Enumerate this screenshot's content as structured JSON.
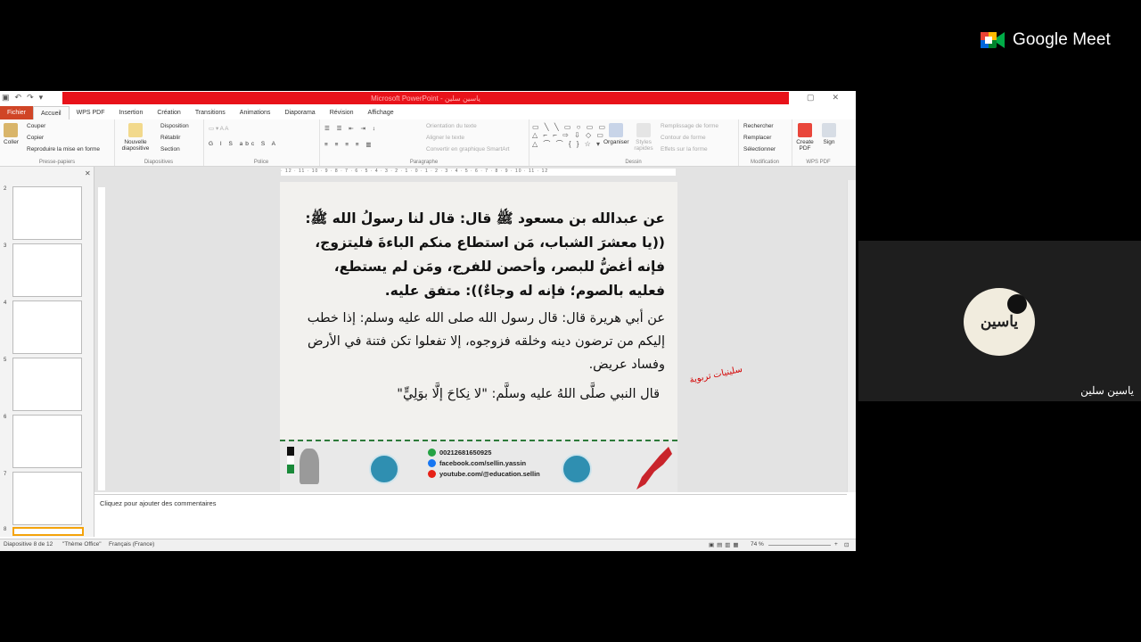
{
  "meet": {
    "brand": "Google Meet"
  },
  "participant": {
    "name": "ياسين سلين",
    "avatar_text": "ياسين"
  },
  "app": {
    "title": "Microsoft PowerPoint - ياسين سلين",
    "tabs": [
      "Fichier",
      "Accueil",
      "WPS PDF",
      "Insertion",
      "Création",
      "Transitions",
      "Animations",
      "Diaporama",
      "Révision",
      "Affichage"
    ],
    "ribbon": {
      "clipboard": {
        "paste": "Coller",
        "cut": "Couper",
        "copy": "Copier",
        "format": "Reproduire la mise en forme",
        "label": "Presse-papiers"
      },
      "slides": {
        "new": "Nouvelle diapositive",
        "layout": "Disposition",
        "reset": "Rétablir",
        "section": "Section",
        "label": "Diapositives"
      },
      "font": {
        "label": "Police"
      },
      "paragraph": {
        "direction": "Orientation du texte",
        "align": "Aligner le texte",
        "smartart": "Convertir en graphique SmartArt",
        "label": "Paragraphe"
      },
      "drawing": {
        "arrange": "Organiser",
        "styles": "Styles rapides",
        "fill": "Remplissage de forme",
        "outline": "Contour de forme",
        "effects": "Effets sur la forme",
        "label": "Dessin"
      },
      "editing": {
        "find": "Rechercher",
        "replace": "Remplacer",
        "select": "Sélectionner",
        "label": "Modification"
      },
      "wps": {
        "create": "Create PDF",
        "sign": "Sign",
        "label": "WPS PDF"
      }
    }
  },
  "slide": {
    "p1": "عن عبدالله بن مسعود ﷺ قال: قال لنا رسولُ الله ﷺ: ((يا معشرَ الشباب، مَن استطاع منكم الباءةَ فليتزوج، فإنه أغضُّ للبصر، وأحصن للفرج، ومَن لم يستطع، فعليه بالصوم؛ فإنه له وجاءٌ)): متفق عليه.",
    "p2": "عن أبي هريرة قال: قال رسول الله صلى الله عليه وسلم: إذا خطب إليكم من ترضون دينه وخلقه فزوجوه، إلا تفعلوا تكن فتنة في الأرض وفساد عريض.",
    "p3": "قال النبي صلَّى اللهُ عليه وسلَّم: \"لا نِكاحَ إلَّا بوَلِيٍّ\"",
    "phone": "00212681650925",
    "facebook": "facebook.com/sellin.yassin",
    "youtube": "youtube.com/@education.sellin"
  },
  "watermark": "سلينيات تربوية",
  "notes_placeholder": "Cliquez pour ajouter des commentaires",
  "status": {
    "slide": "Diapositive 8 de 12",
    "theme": "\"Thème Office\"",
    "lang": "Français (France)",
    "zoom": "74 %"
  },
  "thumbnails": [
    "2",
    "3",
    "4",
    "5",
    "6",
    "7",
    "8"
  ],
  "colors": {
    "accent_red": "#e8121a",
    "file_tab": "#d04526",
    "selected_thumb": "#f4a30b"
  }
}
